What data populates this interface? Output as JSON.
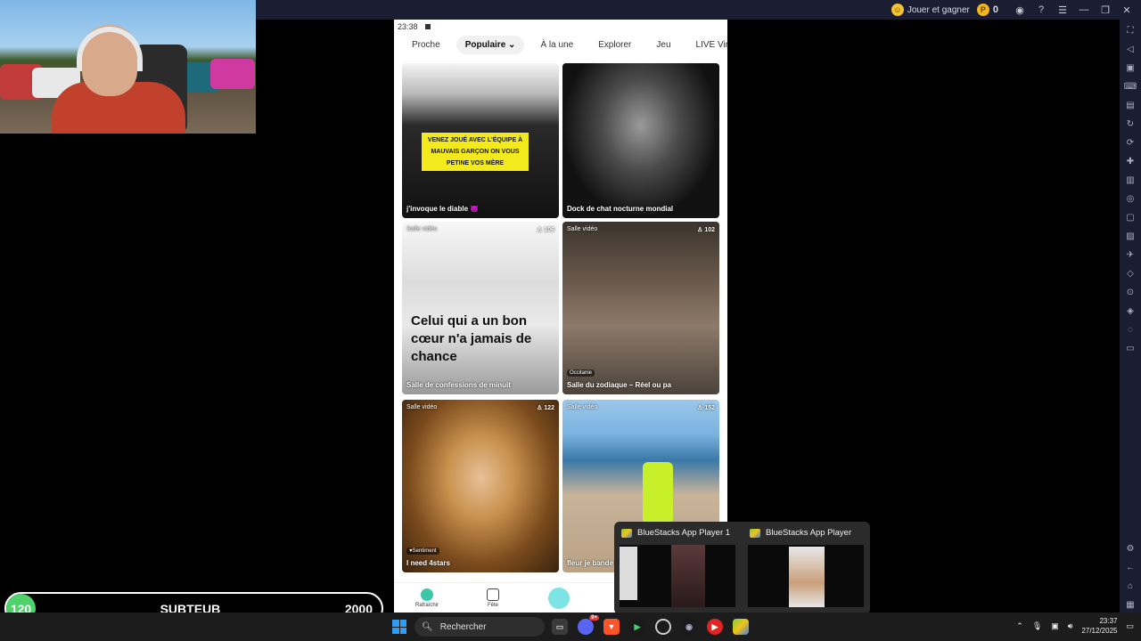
{
  "topbar": {
    "play_earn_label": "Jouer et gagner",
    "coin_count": "0",
    "icons": [
      "account-icon",
      "help-icon",
      "menu-icon",
      "minimize-icon",
      "restore-icon",
      "close-icon"
    ]
  },
  "phone": {
    "status_time": "23:38",
    "tabs": [
      "Proche",
      "Populaire",
      "À la une",
      "Explorer",
      "Jeu",
      "LIVE Virtuel"
    ],
    "active_tab": "Populaire",
    "cards": [
      {
        "title": "j'invoque le diable 😈",
        "banner": "VENEZ JOUÉ AVEC L'ÉQUIPE À MAUVAIS GARÇON ON VOUS PETINE VOS MÈRE"
      },
      {
        "title": "Dock de chat nocturne mondial"
      },
      {
        "tag": "Salle vidéo",
        "count": "106",
        "quote": "Celui qui a un bon cœur n'a jamais de chance",
        "title": "Salle de confessions de minuit"
      },
      {
        "tag": "Salle vidéo",
        "count": "102",
        "region": "Occitanie",
        "title": "Salle du zodiaque – Réel ou pa"
      },
      {
        "tag": "Salle vidéo",
        "count": "122",
        "badge": "Sentiment",
        "title": "I need 4stars"
      },
      {
        "tag": "Salle vidéo",
        "count": "152",
        "title": "fleur je bande"
      }
    ],
    "nav": [
      "Rafraîchir",
      "Fête"
    ]
  },
  "preview": {
    "windows": [
      "BlueStacks App Player 1",
      "BlueStacks App Player"
    ]
  },
  "goal": {
    "current": "120",
    "name": "SUBTEUB",
    "target": "2000"
  },
  "taskbar": {
    "search_placeholder": "Rechercher",
    "discord_badge": "9+",
    "time": "23:37",
    "date": "27/12/2025"
  }
}
